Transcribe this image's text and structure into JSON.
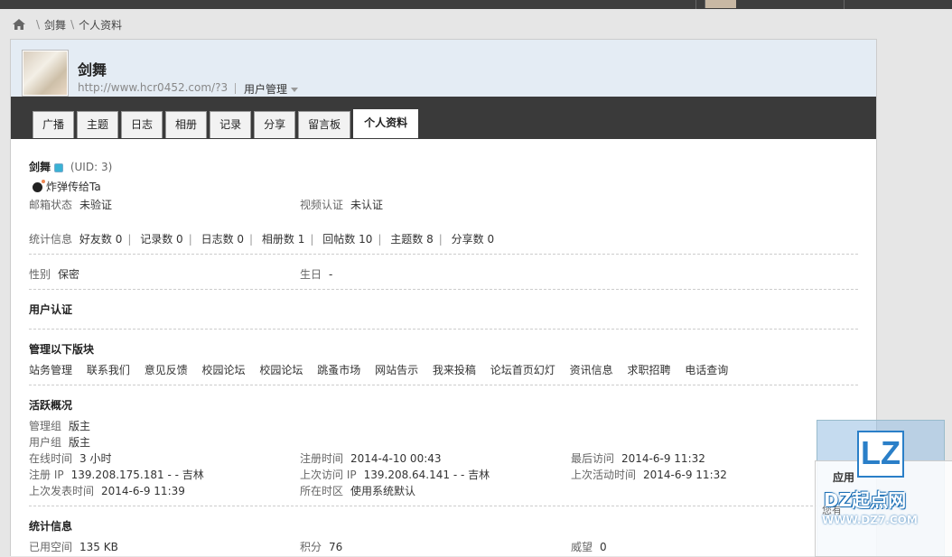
{
  "breadcrumb": {
    "items": [
      "剑舞",
      "个人资料"
    ]
  },
  "profile": {
    "name": "剑舞",
    "url": "http://www.hcr0452.com/?3",
    "manage_label": "用户管理"
  },
  "tabs": [
    {
      "label": "广播",
      "active": false
    },
    {
      "label": "主题",
      "active": false
    },
    {
      "label": "日志",
      "active": false
    },
    {
      "label": "相册",
      "active": false
    },
    {
      "label": "记录",
      "active": false
    },
    {
      "label": "分享",
      "active": false
    },
    {
      "label": "留言板",
      "active": false
    },
    {
      "label": "个人资料",
      "active": true
    }
  ],
  "info": {
    "name": "剑舞",
    "uid": "(UID: 3)",
    "bomb_link": "炸弹传给Ta",
    "email_label": "邮箱状态",
    "email_value": "未验证",
    "video_label": "视频认证",
    "video_value": "未认证",
    "stats_label": "统计信息",
    "stats": [
      {
        "label": "好友数",
        "value": "0"
      },
      {
        "label": "记录数",
        "value": "0"
      },
      {
        "label": "日志数",
        "value": "0"
      },
      {
        "label": "相册数",
        "value": "1"
      },
      {
        "label": "回帖数",
        "value": "10"
      },
      {
        "label": "主题数",
        "value": "8"
      },
      {
        "label": "分享数",
        "value": "0"
      }
    ],
    "gender_label": "性别",
    "gender_value": "保密",
    "birthday_label": "生日",
    "birthday_value": "-"
  },
  "auth": {
    "title": "用户认证"
  },
  "forums": {
    "title": "管理以下版块",
    "items": [
      "站务管理",
      "联系我们",
      "意见反馈",
      "校园论坛",
      "校园论坛",
      "跳蚤市场",
      "网站告示",
      "我来投稿",
      "论坛首页幻灯",
      "资讯信息",
      "求职招聘",
      "电话查询"
    ]
  },
  "activity": {
    "title": "活跃概况",
    "admin_group_label": "管理组",
    "admin_group_value": "版主",
    "user_group_label": "用户组",
    "user_group_value": "版主",
    "online_label": "在线时间",
    "online_value": "3 小时",
    "reg_time_label": "注册时间",
    "reg_time_value": "2014-4-10 00:43",
    "last_visit_label": "最后访问",
    "last_visit_value": "2014-6-9 11:32",
    "reg_ip_label": "注册 IP",
    "reg_ip_value": "139.208.175.181 - - 吉林",
    "last_ip_label": "上次访问 IP",
    "last_ip_value": "139.208.64.141 - - 吉林",
    "last_active_label": "上次活动时间",
    "last_active_value": "2014-6-9 11:32",
    "last_post_label": "上次发表时间",
    "last_post_value": "2014-6-9 11:39",
    "timezone_label": "所在时区",
    "timezone_value": "使用系统默认"
  },
  "statistics": {
    "title": "统计信息",
    "space_label": "已用空间",
    "space_value": "135 KB",
    "points_label": "积分",
    "points_value": "76",
    "prestige_label": "威望",
    "prestige_value": "0"
  },
  "watermark": {
    "logo_letters": "LZ",
    "app_label": "应用",
    "line_text": "您有",
    "brand": "DZ起点网",
    "url": "WWW.DZ7.COM"
  }
}
